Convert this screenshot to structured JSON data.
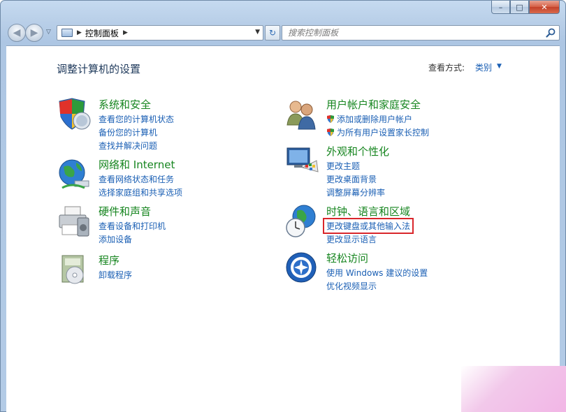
{
  "window": {
    "caption_buttons": {
      "minimize": "–",
      "maximize": "□",
      "close": "✕"
    }
  },
  "navbar": {
    "back_glyph": "◀",
    "forward_glyph": "▶",
    "recent_glyph": "▽",
    "breadcrumb_sep": "▶",
    "address": "控制面板",
    "address_sep2": "▶",
    "dropdown_glyph": "▼",
    "refresh_glyph": "↻",
    "search_placeholder": "搜索控制面板"
  },
  "content": {
    "title": "调整计算机的设置",
    "view_by_label": "查看方式:",
    "view_by_value": "类别",
    "view_caret": "▼"
  },
  "categories": [
    {
      "id": "system-security",
      "icon": "shield-pc-icon",
      "title": "系统和安全",
      "links": [
        "查看您的计算机状态",
        "备份您的计算机",
        "查找并解决问题"
      ]
    },
    {
      "id": "network-internet",
      "icon": "network-globe-icon",
      "title": "网络和 Internet",
      "links": [
        "查看网络状态和任务",
        "选择家庭组和共享选项"
      ]
    },
    {
      "id": "hardware-sound",
      "icon": "printer-icon",
      "title": "硬件和声音",
      "links": [
        "查看设备和打印机",
        "添加设备"
      ]
    },
    {
      "id": "programs",
      "icon": "program-disc-icon",
      "title": "程序",
      "links": [
        "卸载程序"
      ]
    },
    {
      "id": "user-accounts",
      "icon": "users-icon",
      "title": "用户帐户和家庭安全",
      "links": [
        "添加或删除用户帐户",
        "为所有用户设置家长控制"
      ]
    },
    {
      "id": "appearance",
      "icon": "monitor-palette-icon",
      "title": "外观和个性化",
      "links": [
        "更改主题",
        "更改桌面背景",
        "调整屏幕分辨率"
      ]
    },
    {
      "id": "clock-region",
      "icon": "globe-clock-icon",
      "title": "时钟、语言和区域",
      "links": [
        "更改键盘或其他输入法",
        "更改显示语言"
      ]
    },
    {
      "id": "ease-of-access",
      "icon": "ease-access-icon",
      "title": "轻松访问",
      "links": [
        "使用 Windows 建议的设置",
        "优化视频显示"
      ]
    }
  ],
  "colors": {
    "link": "#1a5fb4",
    "category_title": "#16851f",
    "highlight_box": "#d9262b"
  }
}
